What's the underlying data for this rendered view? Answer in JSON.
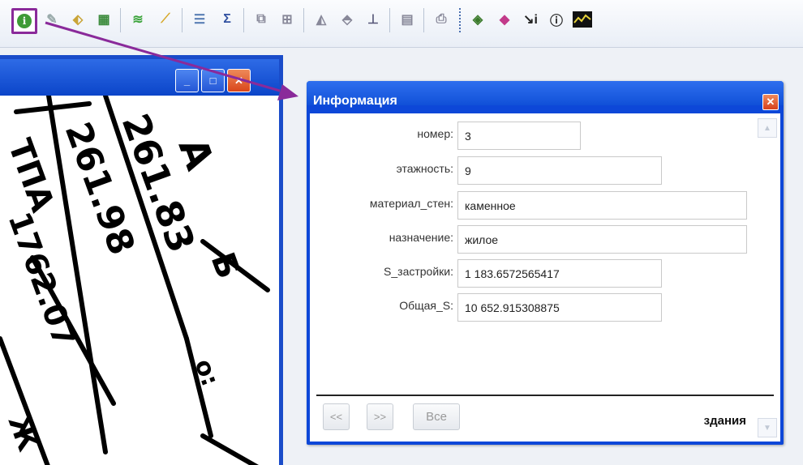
{
  "dialog": {
    "title": "Информация",
    "fields": [
      {
        "label": "номер:",
        "value": "3"
      },
      {
        "label": "этажность:",
        "value": "9"
      },
      {
        "label": "материал_стен:",
        "value": "каменное"
      },
      {
        "label": "назначение:",
        "value": "жилое"
      },
      {
        "label": "S_застройки:",
        "value": "1 183.6572565417"
      },
      {
        "label": "Общая_S:",
        "value": "10 652.915308875"
      }
    ],
    "prev_label": "<<",
    "next_label": ">>",
    "all_label": "Все",
    "layer_name": "здания"
  },
  "toolbar": {
    "icons": [
      "info-icon",
      "draw-icon",
      "tag-icon",
      "map-tool-icon",
      "layers-icon",
      "ruler-icon",
      "legend-icon",
      "sum-icon",
      "select-icon",
      "table-icon",
      "area-icon",
      "volume-icon",
      "scale-icon",
      "report-icon",
      "print-icon",
      "layer-stack-icon",
      "color-icon",
      "measure-info-icon",
      "info-outline-icon",
      "graph-icon"
    ]
  },
  "colors": {
    "accent": "#0d47d8",
    "highlight": "#8a2a9a"
  }
}
